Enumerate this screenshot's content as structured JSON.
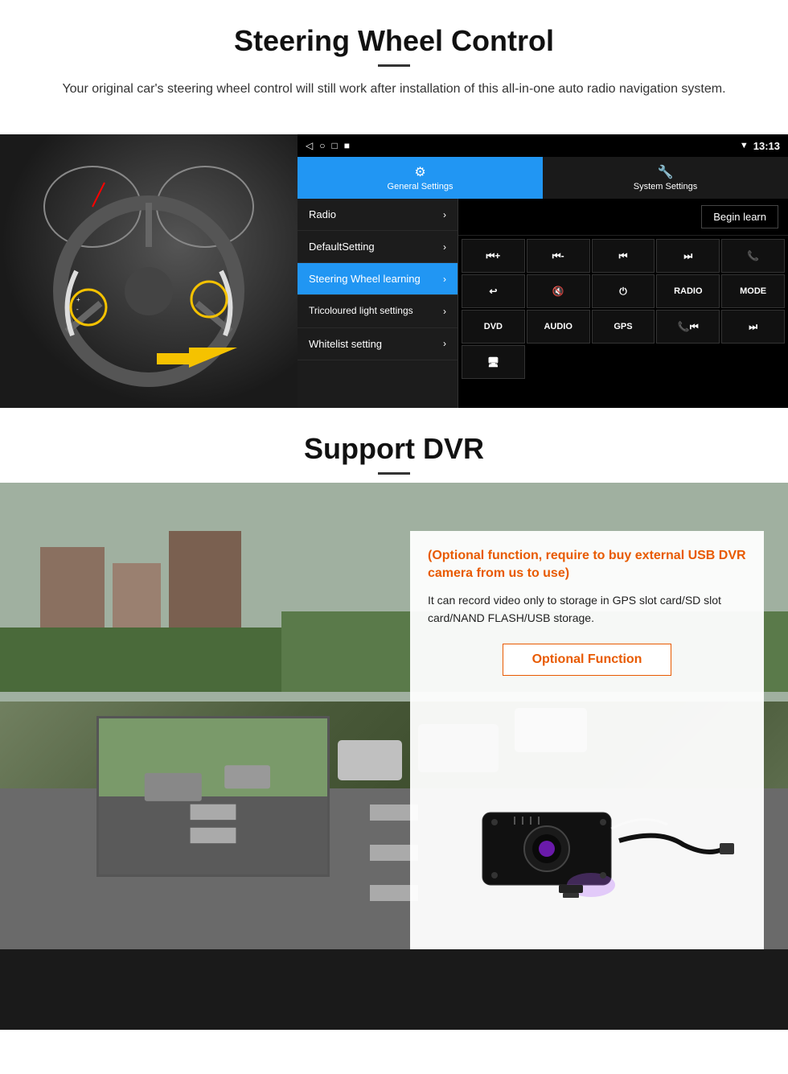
{
  "steering": {
    "title": "Steering Wheel Control",
    "description": "Your original car's steering wheel control will still work after installation of this all-in-one auto radio navigation system.",
    "status_bar": {
      "time": "13:13",
      "nav_icons": [
        "◁",
        "○",
        "□",
        "■"
      ]
    },
    "tabs": [
      {
        "label": "General Settings",
        "active": true
      },
      {
        "label": "System Settings",
        "active": false
      }
    ],
    "menu_items": [
      {
        "label": "Radio",
        "active": false
      },
      {
        "label": "DefaultSetting",
        "active": false
      },
      {
        "label": "Steering Wheel learning",
        "active": true
      },
      {
        "label": "Tricoloured light settings",
        "active": false
      },
      {
        "label": "Whitelist setting",
        "active": false
      }
    ],
    "begin_learn": "Begin learn",
    "controls": [
      "⏮+",
      "⏮-",
      "⏮",
      "⏭",
      "📞",
      "↩",
      "🔇",
      "⏻",
      "RADIO",
      "MODE",
      "DVD",
      "AUDIO",
      "GPS",
      "📞⏮",
      "⏭"
    ]
  },
  "dvr": {
    "title": "Support DVR",
    "card_title": "(Optional function, require to buy external USB DVR camera from us to use)",
    "card_description": "It can record video only to storage in GPS slot card/SD slot card/NAND FLASH/USB storage.",
    "optional_function_label": "Optional Function"
  }
}
